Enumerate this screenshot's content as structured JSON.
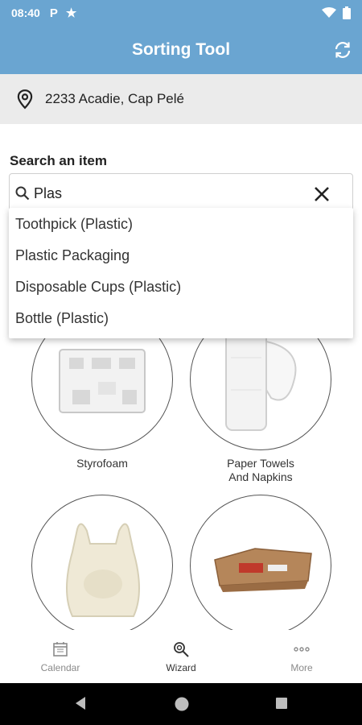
{
  "status": {
    "time": "08:40",
    "icons": [
      "parking-icon",
      "star-icon",
      "wifi-icon",
      "battery-icon"
    ]
  },
  "app": {
    "title": "Sorting Tool",
    "refresh_icon": "refresh-icon"
  },
  "address": {
    "text": "2233 Acadie, Cap Pelé",
    "icon": "location-pin-icon"
  },
  "search": {
    "label": "Search an item",
    "value": "Plas",
    "placeholder": "",
    "suggestions": [
      "Toothpick (Plastic)",
      "Plastic Packaging",
      "Disposable Cups (Plastic)",
      "Bottle (Plastic)"
    ]
  },
  "items": [
    {
      "label": "Styrofoam",
      "label2": ""
    },
    {
      "label": "Paper Towels",
      "label2": "And Napkins"
    },
    {
      "label": "",
      "label2": ""
    },
    {
      "label": "",
      "label2": ""
    }
  ],
  "bottom_nav": {
    "calendar": "Calendar",
    "wizard": "Wizard",
    "more": "More",
    "active": "Wizard"
  },
  "colors": {
    "primary": "#6aa5d1",
    "address_bg": "#ebebeb",
    "inactive_tab": "#8a8a8a"
  }
}
